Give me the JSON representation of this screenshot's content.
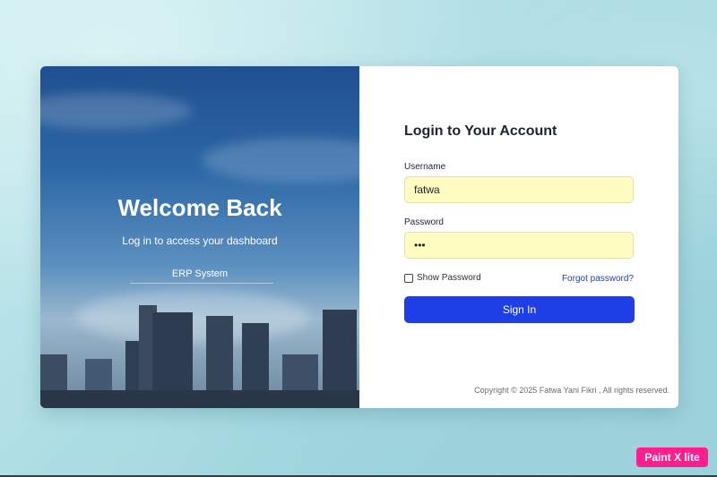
{
  "hero": {
    "welcome_title": "Welcome Back",
    "subtitle": "Log in to access your dashboard",
    "system_name": "ERP System"
  },
  "login": {
    "title": "Login to Your Account",
    "username_label": "Username",
    "username_value": "fatwa",
    "password_label": "Password",
    "password_value": "•••",
    "show_password_label": "Show Password",
    "forgot_password_link": "Forgot password?",
    "sign_in_button": "Sign In",
    "copyright": "Copyright © 2025 Fatwa Yani Fikri , All rights reserved."
  },
  "overlay": {
    "watermark_badge": "Paint X lite"
  },
  "colors": {
    "primary_button": "#1f3fe6",
    "autofill_field": "#fefcc0",
    "link": "#1e3fa8",
    "badge": "#ff1e8f"
  }
}
